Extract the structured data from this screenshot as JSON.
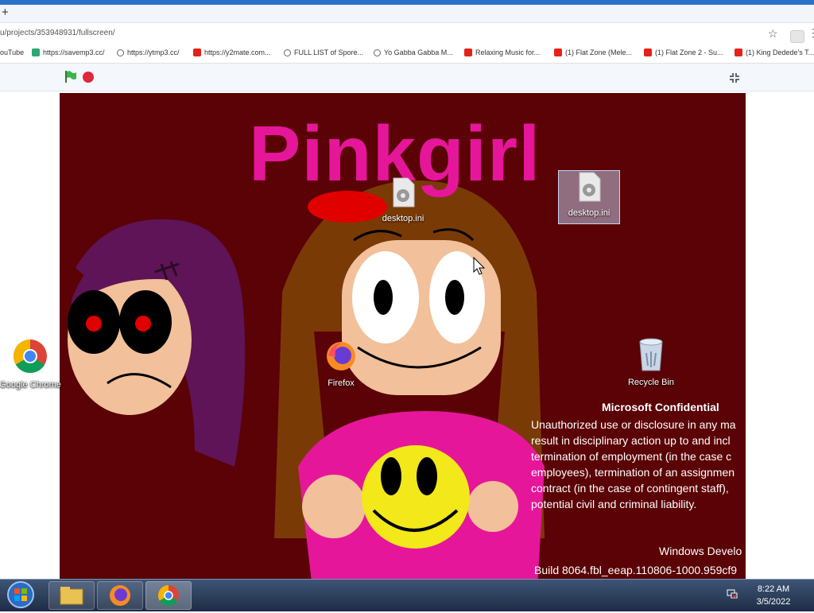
{
  "browser": {
    "new_tab": "+",
    "url": "u/projects/353948931/fullscreen/",
    "star": "☆",
    "menu": "⋮",
    "bookmarks": [
      {
        "label": "ouTube",
        "icon": "none"
      },
      {
        "label": "https://savemp3.cc/",
        "icon": "green"
      },
      {
        "label": "https://ytmp3.cc/",
        "icon": "globe"
      },
      {
        "label": "https://y2mate.com...",
        "icon": "youtube"
      },
      {
        "label": "FULL LIST of Spore...",
        "icon": "globe"
      },
      {
        "label": "Yo Gabba Gabba M...",
        "icon": "globe"
      },
      {
        "label": "Relaxing Music for...",
        "icon": "youtube"
      },
      {
        "label": "(1) Flat Zone (Mele...",
        "icon": "youtube"
      },
      {
        "label": "(1) Flat Zone 2 - Su...",
        "icon": "youtube"
      },
      {
        "label": "(1) King Dedede's T...",
        "icon": "youtube"
      }
    ]
  },
  "scratch": {
    "flag_color": "#3cb44b",
    "stop_color": "#e0263a",
    "stage_bg": "#5a0205",
    "title": "Pinkgirl"
  },
  "desktop": {
    "icons": {
      "chrome": "Google Chrome",
      "firefox": "Firefox",
      "desktop_ini_1": "desktop.ini",
      "desktop_ini_2": "desktop.ini",
      "recycle_bin": "Recycle Bin"
    },
    "watermark": {
      "heading": "Microsoft Confidential",
      "lines": [
        "Unauthorized use or disclosure in any ma",
        "result in disciplinary action up to and incl",
        "termination of employment (in the case c",
        "employees), termination of an assignmen",
        "contract (in the case of contingent staff),",
        "potential civil and criminal liability."
      ],
      "os_line": "Windows Develo",
      "build_line": "Build 8064.fbl_eeap.110806-1000.959cf9"
    }
  },
  "taskbar": {
    "time": "8:22 AM",
    "date": "3/5/2022"
  }
}
